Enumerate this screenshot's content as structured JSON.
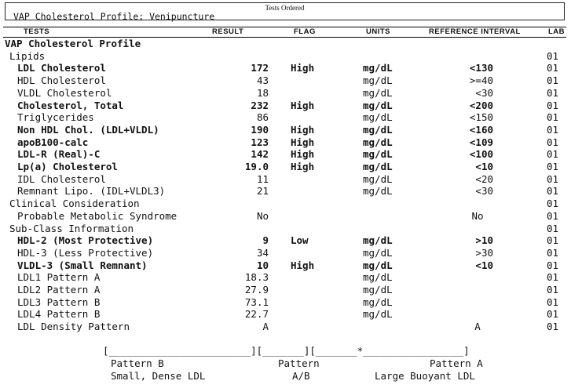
{
  "tests_ordered": {
    "label": "Tests Ordered",
    "value": "VAP Cholesterol Profile; Venipuncture"
  },
  "columns": {
    "tests": "TESTS",
    "result": "RESULT",
    "flag": "FLAG",
    "units": "UNITS",
    "reference": "REFERENCE INTERVAL",
    "lab": "LAB"
  },
  "rows": [
    {
      "name": "VAP Cholesterol Profile",
      "result": "",
      "flag": "",
      "units": "",
      "ref": "",
      "lab": "",
      "level": 0,
      "bold": true
    },
    {
      "name": "Lipids",
      "result": "",
      "flag": "",
      "units": "",
      "ref": "",
      "lab": "01",
      "level": 1,
      "bold": false
    },
    {
      "name": "LDL Cholesterol",
      "result": "172",
      "flag": "High",
      "units": "mg/dL",
      "ref": "<130",
      "lab": "01",
      "level": 2,
      "bold": true
    },
    {
      "name": "HDL Cholesterol",
      "result": "43",
      "flag": "",
      "units": "mg/dL",
      "ref": ">=40",
      "lab": "01",
      "level": 2,
      "bold": false
    },
    {
      "name": "VLDL Cholesterol",
      "result": "18",
      "flag": "",
      "units": "mg/dL",
      "ref": "<30",
      "lab": "01",
      "level": 2,
      "bold": false
    },
    {
      "name": "Cholesterol, Total",
      "result": "232",
      "flag": "High",
      "units": "mg/dL",
      "ref": "<200",
      "lab": "01",
      "level": 2,
      "bold": true
    },
    {
      "name": "Triglycerides",
      "result": "86",
      "flag": "",
      "units": "mg/dL",
      "ref": "<150",
      "lab": "01",
      "level": 2,
      "bold": false
    },
    {
      "name": "Non HDL Chol. (LDL+VLDL)",
      "result": "190",
      "flag": "High",
      "units": "mg/dL",
      "ref": "<160",
      "lab": "01",
      "level": 2,
      "bold": true
    },
    {
      "name": "apoB100-calc",
      "result": "123",
      "flag": "High",
      "units": "mg/dL",
      "ref": "<109",
      "lab": "01",
      "level": 2,
      "bold": true
    },
    {
      "name": "LDL-R (Real)-C",
      "result": "142",
      "flag": "High",
      "units": "mg/dL",
      "ref": "<100",
      "lab": "01",
      "level": 2,
      "bold": true
    },
    {
      "name": "Lp(a) Cholesterol",
      "result": "19.0",
      "flag": "High",
      "units": "mg/dL",
      "ref": "<10",
      "lab": "01",
      "level": 2,
      "bold": true
    },
    {
      "name": "IDL Cholesterol",
      "result": "11",
      "flag": "",
      "units": "mg/dL",
      "ref": "<20",
      "lab": "01",
      "level": 2,
      "bold": false
    },
    {
      "name": "Remnant Lipo. (IDL+VLDL3)",
      "result": "21",
      "flag": "",
      "units": "mg/dL",
      "ref": "<30",
      "lab": "01",
      "level": 2,
      "bold": false
    },
    {
      "name": "Clinical Consideration",
      "result": "",
      "flag": "",
      "units": "",
      "ref": "",
      "lab": "01",
      "level": 1,
      "bold": false
    },
    {
      "name": "Probable Metabolic Syndrome",
      "result": "No",
      "flag": "",
      "units": "",
      "ref": "No",
      "refCenter": true,
      "lab": "01",
      "level": 2,
      "bold": false
    },
    {
      "name": "Sub-Class Information",
      "result": "",
      "flag": "",
      "units": "",
      "ref": "",
      "lab": "01",
      "level": 1,
      "bold": false
    },
    {
      "name": "HDL-2 (Most Protective)",
      "result": "9",
      "flag": "Low",
      "units": "mg/dL",
      "ref": ">10",
      "lab": "01",
      "level": 2,
      "bold": true
    },
    {
      "name": "HDL-3 (Less Protective)",
      "result": "34",
      "flag": "",
      "units": "mg/dL",
      "ref": ">30",
      "lab": "01",
      "level": 2,
      "bold": false
    },
    {
      "name": "VLDL-3 (Small Remnant)",
      "result": "10",
      "flag": "High",
      "units": "mg/dL",
      "ref": "<10",
      "lab": "01",
      "level": 2,
      "bold": true
    },
    {
      "name": "LDL1 Pattern A",
      "result": "18.3",
      "flag": "",
      "units": "mg/dL",
      "ref": "",
      "lab": "01",
      "level": 2,
      "bold": false
    },
    {
      "name": "LDL2 Pattern A",
      "result": "27.9",
      "flag": "",
      "units": "mg/dL",
      "ref": "",
      "lab": "01",
      "level": 2,
      "bold": false
    },
    {
      "name": "LDL3 Pattern B",
      "result": "73.1",
      "flag": "",
      "units": "mg/dL",
      "ref": "",
      "lab": "01",
      "level": 2,
      "bold": false
    },
    {
      "name": "LDL4 Pattern B",
      "result": "22.7",
      "flag": "",
      "units": "mg/dL",
      "ref": "",
      "lab": "01",
      "level": 2,
      "bold": false
    },
    {
      "name": "LDL Density Pattern",
      "result": "A",
      "flag": "",
      "units": "",
      "ref": "A",
      "refCenter": true,
      "lab": "01",
      "level": 2,
      "bold": false
    }
  ],
  "pattern_scale": {
    "bar": "[________________________][_______][_______*_________________]",
    "pattern_b": "Pattern B",
    "pattern_ab": "Pattern",
    "pattern_a": "Pattern A",
    "small_dense": "Small, Dense LDL",
    "ab": "A/B",
    "large_buoyant": "Large Buoyant LDL"
  }
}
